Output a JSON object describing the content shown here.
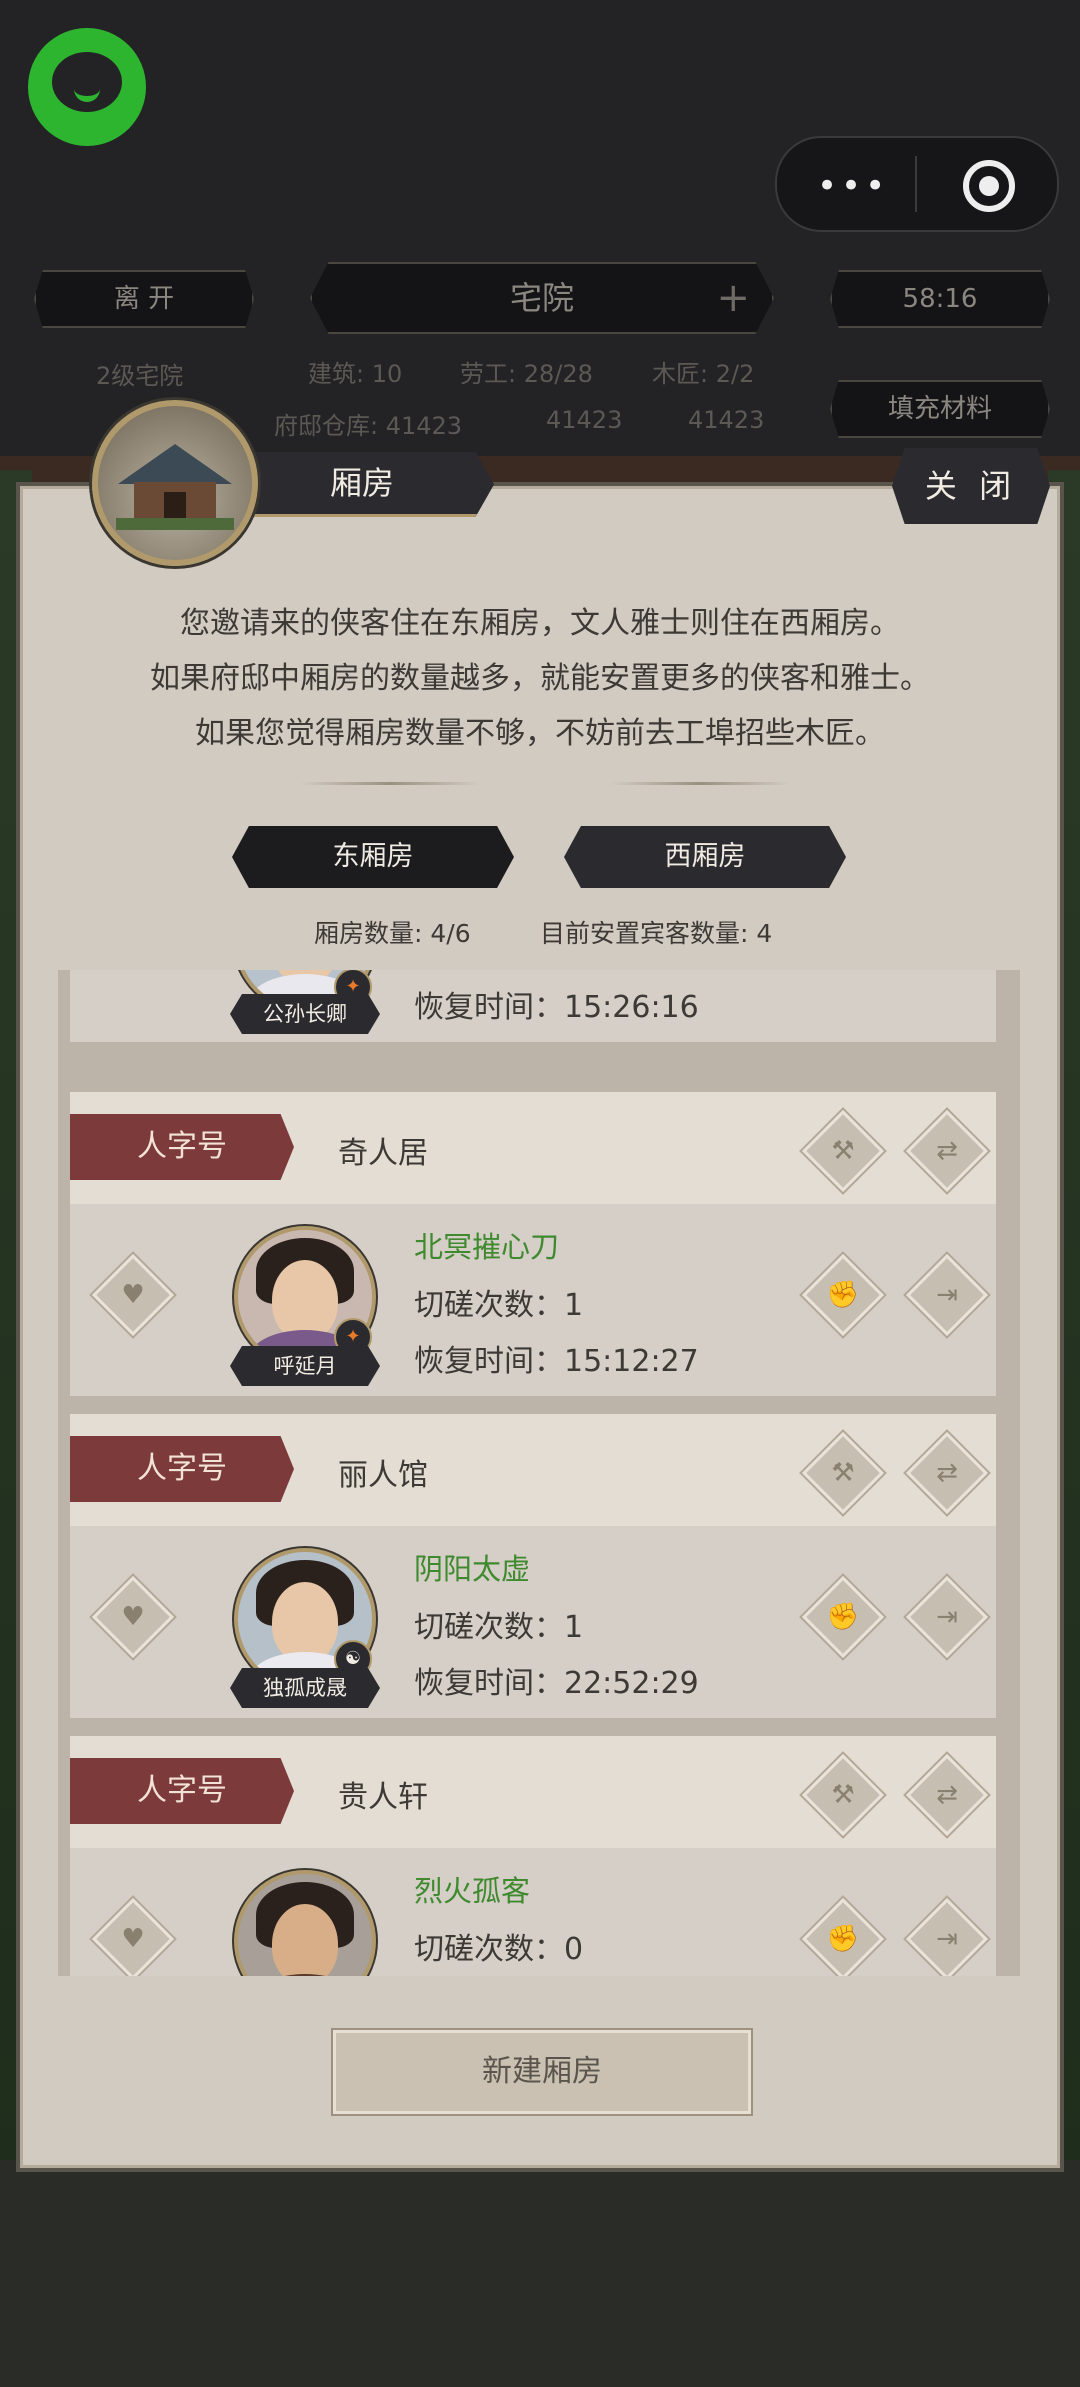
{
  "topbar": {
    "leave_label": "离 开",
    "location_label": "宅院",
    "plus_symbol": "+",
    "timer": "58:16",
    "level_label": "2级宅院",
    "building": "建筑: 10",
    "labor": "劳工: 28/28",
    "carpenter": "木匠: 2/2",
    "warehouse_label": "府邸仓库: 41423",
    "stock_2": "41423",
    "stock_3": "41423",
    "fill_label": "填充材料"
  },
  "panel": {
    "title": "厢房",
    "close_label": "关 闭",
    "intro": [
      "您邀请来的侠客住在东厢房，文人雅士则住在西厢房。",
      "如果府邸中厢房的数量越多，就能安置更多的侠客和雅士。",
      "如果您觉得厢房数量不够，不妨前去工埠招些木匠。"
    ],
    "tabs": [
      "东厢房",
      "西厢房"
    ],
    "room_count": "厢房数量: 4/6",
    "guest_count": "目前安置宾客数量: 4",
    "new_room_label": "新建厢房"
  },
  "rooms": [
    {
      "grade": "",
      "name": "",
      "guest": "公孙长卿",
      "skill": "",
      "spar": "",
      "recover": "恢复时间：15:26:16"
    },
    {
      "grade": "人字号",
      "name": "奇人居",
      "guest": "呼延月",
      "skill": "北冥摧心刀",
      "spar": "切磋次数：1",
      "recover": "恢复时间：15:12:27"
    },
    {
      "grade": "人字号",
      "name": "丽人馆",
      "guest": "独孤成晟",
      "skill": "阴阳太虚",
      "spar": "切磋次数：1",
      "recover": "恢复时间：22:52:29"
    },
    {
      "grade": "人字号",
      "name": "贵人轩",
      "guest": "",
      "skill": "烈火孤客",
      "spar": "切磋次数：0",
      "recover": ""
    }
  ],
  "colors": {
    "grade_bg": "#7c3a3a",
    "skill_text": "#3f8a2e",
    "panel_bg": "#d2cbc2",
    "plate_bg": "#2b2a2e"
  },
  "icons": {
    "favorite": "heart-icon",
    "build": "hammer-icon",
    "swap": "swap-icon",
    "train": "fist-icon",
    "exit": "exit-icon"
  }
}
